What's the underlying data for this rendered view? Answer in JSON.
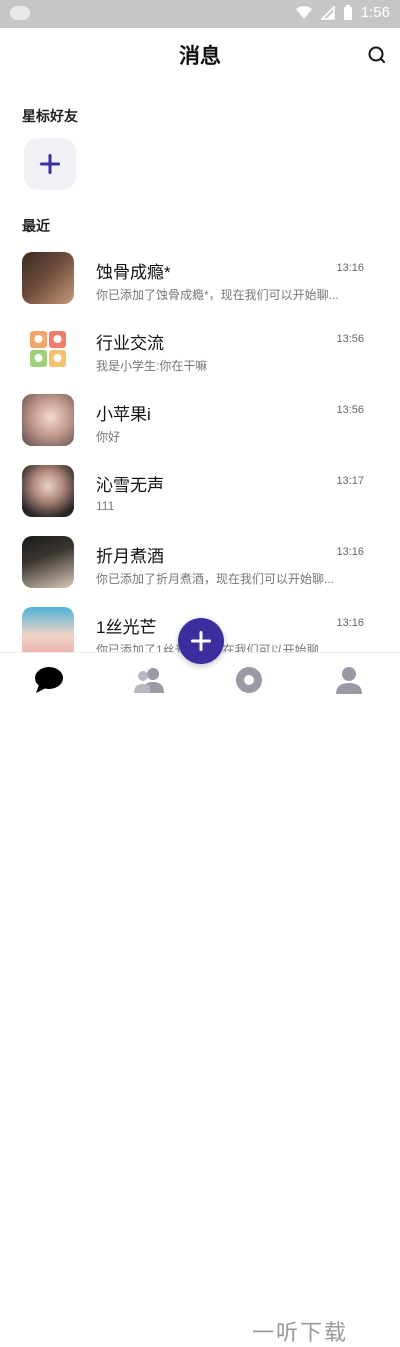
{
  "status_bar": {
    "time": "1:56"
  },
  "header": {
    "title": "消息"
  },
  "sections": {
    "starred": "星标好友",
    "recent": "最近"
  },
  "conversations": [
    {
      "name": "蚀骨成瘾*",
      "time": "13:16",
      "message": "你已添加了蚀骨成瘾*，现在我们可以开始聊..."
    },
    {
      "name": "行业交流",
      "time": "13:56",
      "message": "我是小学生:你在干嘛"
    },
    {
      "name": "小苹果i",
      "time": "13:56",
      "message": "你好"
    },
    {
      "name": "沁雪无声",
      "time": "13:17",
      "message": "111"
    },
    {
      "name": "折月煮酒",
      "time": "13:16",
      "message": "你已添加了折月煮酒，现在我们可以开始聊..."
    },
    {
      "name": "1丝光芒",
      "time": "13:16",
      "message": "你已添加了1丝光芒，现在我们可以开始聊..."
    }
  ],
  "tabs": [
    {
      "icon": "chat-bubble-icon",
      "active": true
    },
    {
      "icon": "contacts-icon",
      "active": false
    },
    {
      "icon": "feed-icon",
      "active": false
    },
    {
      "icon": "profile-icon",
      "active": false
    }
  ],
  "watermark": "一听下载",
  "colors": {
    "accent": "#3b2fa0",
    "text_primary": "#111111",
    "text_secondary": "#777777"
  }
}
